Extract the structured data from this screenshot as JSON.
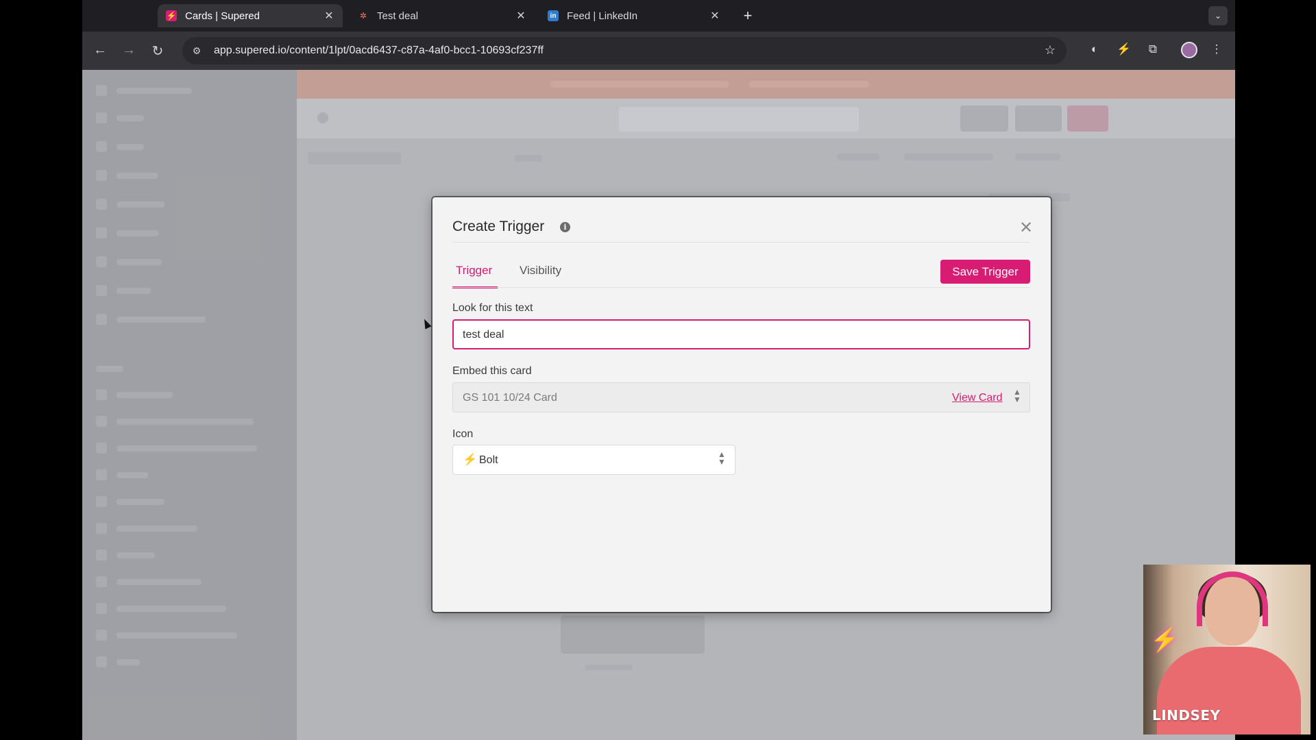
{
  "browser": {
    "tabs": [
      {
        "title": "Cards | Supered",
        "favicon": "supered-bolt-icon",
        "active": true
      },
      {
        "title": "Test deal",
        "favicon": "hubspot-icon",
        "active": false
      },
      {
        "title": "Feed | LinkedIn",
        "favicon": "linkedin-icon",
        "active": false
      }
    ],
    "url": "app.supered.io/content/1lpt/0acd6437-c87a-4af0-bcc1-10693cf237ff"
  },
  "modal": {
    "title": "Create Trigger",
    "tabs": {
      "trigger": "Trigger",
      "visibility": "Visibility"
    },
    "save_label": "Save Trigger",
    "look_for_label": "Look for this text",
    "look_for_value": "test deal",
    "embed_label": "Embed this card",
    "embed_value": "GS 101 10/24 Card",
    "view_card_label": "View Card",
    "icon_label": "Icon",
    "icon_value": "Bolt"
  },
  "webcam": {
    "name": "LINDSEY"
  },
  "colors": {
    "accent": "#d81b73",
    "chrome_dark": "#1f1e22",
    "chrome_toolbar": "#353438"
  }
}
